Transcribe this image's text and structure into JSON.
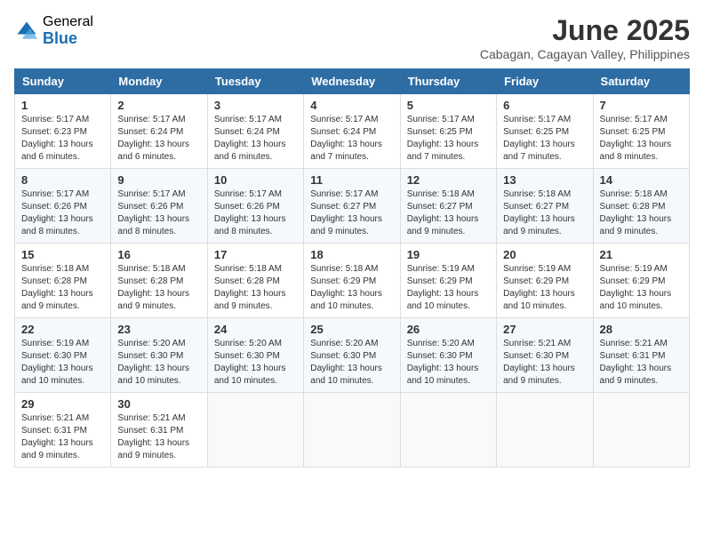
{
  "logo": {
    "general": "General",
    "blue": "Blue"
  },
  "title": {
    "month": "June 2025",
    "location": "Cabagan, Cagayan Valley, Philippines"
  },
  "headers": [
    "Sunday",
    "Monday",
    "Tuesday",
    "Wednesday",
    "Thursday",
    "Friday",
    "Saturday"
  ],
  "weeks": [
    [
      {
        "day": "1",
        "sunrise": "5:17 AM",
        "sunset": "6:23 PM",
        "daylight": "13 hours and 6 minutes."
      },
      {
        "day": "2",
        "sunrise": "5:17 AM",
        "sunset": "6:24 PM",
        "daylight": "13 hours and 6 minutes."
      },
      {
        "day": "3",
        "sunrise": "5:17 AM",
        "sunset": "6:24 PM",
        "daylight": "13 hours and 6 minutes."
      },
      {
        "day": "4",
        "sunrise": "5:17 AM",
        "sunset": "6:24 PM",
        "daylight": "13 hours and 7 minutes."
      },
      {
        "day": "5",
        "sunrise": "5:17 AM",
        "sunset": "6:25 PM",
        "daylight": "13 hours and 7 minutes."
      },
      {
        "day": "6",
        "sunrise": "5:17 AM",
        "sunset": "6:25 PM",
        "daylight": "13 hours and 7 minutes."
      },
      {
        "day": "7",
        "sunrise": "5:17 AM",
        "sunset": "6:25 PM",
        "daylight": "13 hours and 8 minutes."
      }
    ],
    [
      {
        "day": "8",
        "sunrise": "5:17 AM",
        "sunset": "6:26 PM",
        "daylight": "13 hours and 8 minutes."
      },
      {
        "day": "9",
        "sunrise": "5:17 AM",
        "sunset": "6:26 PM",
        "daylight": "13 hours and 8 minutes."
      },
      {
        "day": "10",
        "sunrise": "5:17 AM",
        "sunset": "6:26 PM",
        "daylight": "13 hours and 8 minutes."
      },
      {
        "day": "11",
        "sunrise": "5:17 AM",
        "sunset": "6:27 PM",
        "daylight": "13 hours and 9 minutes."
      },
      {
        "day": "12",
        "sunrise": "5:18 AM",
        "sunset": "6:27 PM",
        "daylight": "13 hours and 9 minutes."
      },
      {
        "day": "13",
        "sunrise": "5:18 AM",
        "sunset": "6:27 PM",
        "daylight": "13 hours and 9 minutes."
      },
      {
        "day": "14",
        "sunrise": "5:18 AM",
        "sunset": "6:28 PM",
        "daylight": "13 hours and 9 minutes."
      }
    ],
    [
      {
        "day": "15",
        "sunrise": "5:18 AM",
        "sunset": "6:28 PM",
        "daylight": "13 hours and 9 minutes."
      },
      {
        "day": "16",
        "sunrise": "5:18 AM",
        "sunset": "6:28 PM",
        "daylight": "13 hours and 9 minutes."
      },
      {
        "day": "17",
        "sunrise": "5:18 AM",
        "sunset": "6:28 PM",
        "daylight": "13 hours and 9 minutes."
      },
      {
        "day": "18",
        "sunrise": "5:18 AM",
        "sunset": "6:29 PM",
        "daylight": "13 hours and 10 minutes."
      },
      {
        "day": "19",
        "sunrise": "5:19 AM",
        "sunset": "6:29 PM",
        "daylight": "13 hours and 10 minutes."
      },
      {
        "day": "20",
        "sunrise": "5:19 AM",
        "sunset": "6:29 PM",
        "daylight": "13 hours and 10 minutes."
      },
      {
        "day": "21",
        "sunrise": "5:19 AM",
        "sunset": "6:29 PM",
        "daylight": "13 hours and 10 minutes."
      }
    ],
    [
      {
        "day": "22",
        "sunrise": "5:19 AM",
        "sunset": "6:30 PM",
        "daylight": "13 hours and 10 minutes."
      },
      {
        "day": "23",
        "sunrise": "5:20 AM",
        "sunset": "6:30 PM",
        "daylight": "13 hours and 10 minutes."
      },
      {
        "day": "24",
        "sunrise": "5:20 AM",
        "sunset": "6:30 PM",
        "daylight": "13 hours and 10 minutes."
      },
      {
        "day": "25",
        "sunrise": "5:20 AM",
        "sunset": "6:30 PM",
        "daylight": "13 hours and 10 minutes."
      },
      {
        "day": "26",
        "sunrise": "5:20 AM",
        "sunset": "6:30 PM",
        "daylight": "13 hours and 10 minutes."
      },
      {
        "day": "27",
        "sunrise": "5:21 AM",
        "sunset": "6:30 PM",
        "daylight": "13 hours and 9 minutes."
      },
      {
        "day": "28",
        "sunrise": "5:21 AM",
        "sunset": "6:31 PM",
        "daylight": "13 hours and 9 minutes."
      }
    ],
    [
      {
        "day": "29",
        "sunrise": "5:21 AM",
        "sunset": "6:31 PM",
        "daylight": "13 hours and 9 minutes."
      },
      {
        "day": "30",
        "sunrise": "5:21 AM",
        "sunset": "6:31 PM",
        "daylight": "13 hours and 9 minutes."
      },
      null,
      null,
      null,
      null,
      null
    ]
  ],
  "cell_labels": {
    "sunrise": "Sunrise: ",
    "sunset": "Sunset: ",
    "daylight": "Daylight: "
  }
}
